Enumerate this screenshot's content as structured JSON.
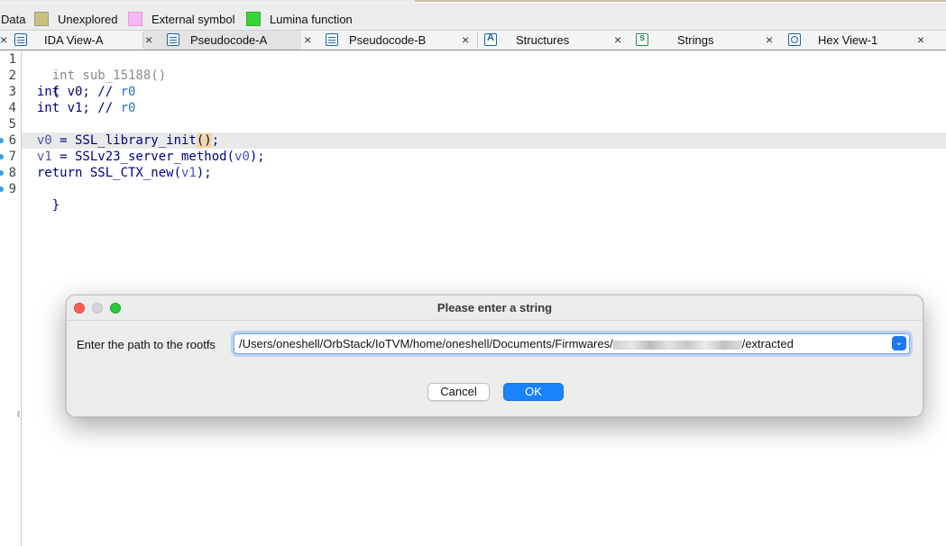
{
  "legend": {
    "items": [
      {
        "label": "Data",
        "color": ""
      },
      {
        "label": "Unexplored",
        "color": "#c8c27a"
      },
      {
        "label": "External symbol",
        "color": "#f7b8f3"
      },
      {
        "label": "Lumina function",
        "color": "#3bd13b"
      }
    ]
  },
  "tabs": [
    {
      "label": "IDA View-A",
      "icon": "disassembly-icon",
      "active": false
    },
    {
      "label": "Pseudocode-A",
      "icon": "pseudocode-icon",
      "active": true
    },
    {
      "label": "Pseudocode-B",
      "icon": "pseudocode-icon",
      "active": false
    },
    {
      "label": "Structures",
      "icon": "structures-icon",
      "active": false
    },
    {
      "label": "Strings",
      "icon": "strings-icon",
      "active": false
    },
    {
      "label": "Hex View-1",
      "icon": "hex-view-icon",
      "active": false
    }
  ],
  "tab_close_glyph": "×",
  "code": {
    "line_numbers": [
      "1",
      "2",
      "3",
      "4",
      "5",
      "6",
      "7",
      "8",
      "9"
    ],
    "l1": "int sub_15188()",
    "l2": "{",
    "l3_kw": "  int v0; // ",
    "l3_reg": "r0",
    "l4_kw": "  int v1; // ",
    "l4_reg": "r0",
    "l6_var": "v0",
    "l6_mid": " = SSL_library_init",
    "l6_parens": "()",
    "l6_end": ";",
    "l7_var": "v1",
    "l7_mid": " = SSLv23_server_method(",
    "l7_arg": "v0",
    "l7_end": ");",
    "l8_kw": "  return SSL_CTX_new(",
    "l8_arg": "v1",
    "l8_end": ");",
    "l9": "}"
  },
  "dialog": {
    "title": "Please enter a string",
    "label": "Enter the path to the rootfs",
    "path_prefix": "/Users/oneshell/OrbStack/IoTVM/home/oneshell/Documents/Firmwares/",
    "path_suffix": "/extracted",
    "cancel_label": "Cancel",
    "ok_label": "OK"
  }
}
